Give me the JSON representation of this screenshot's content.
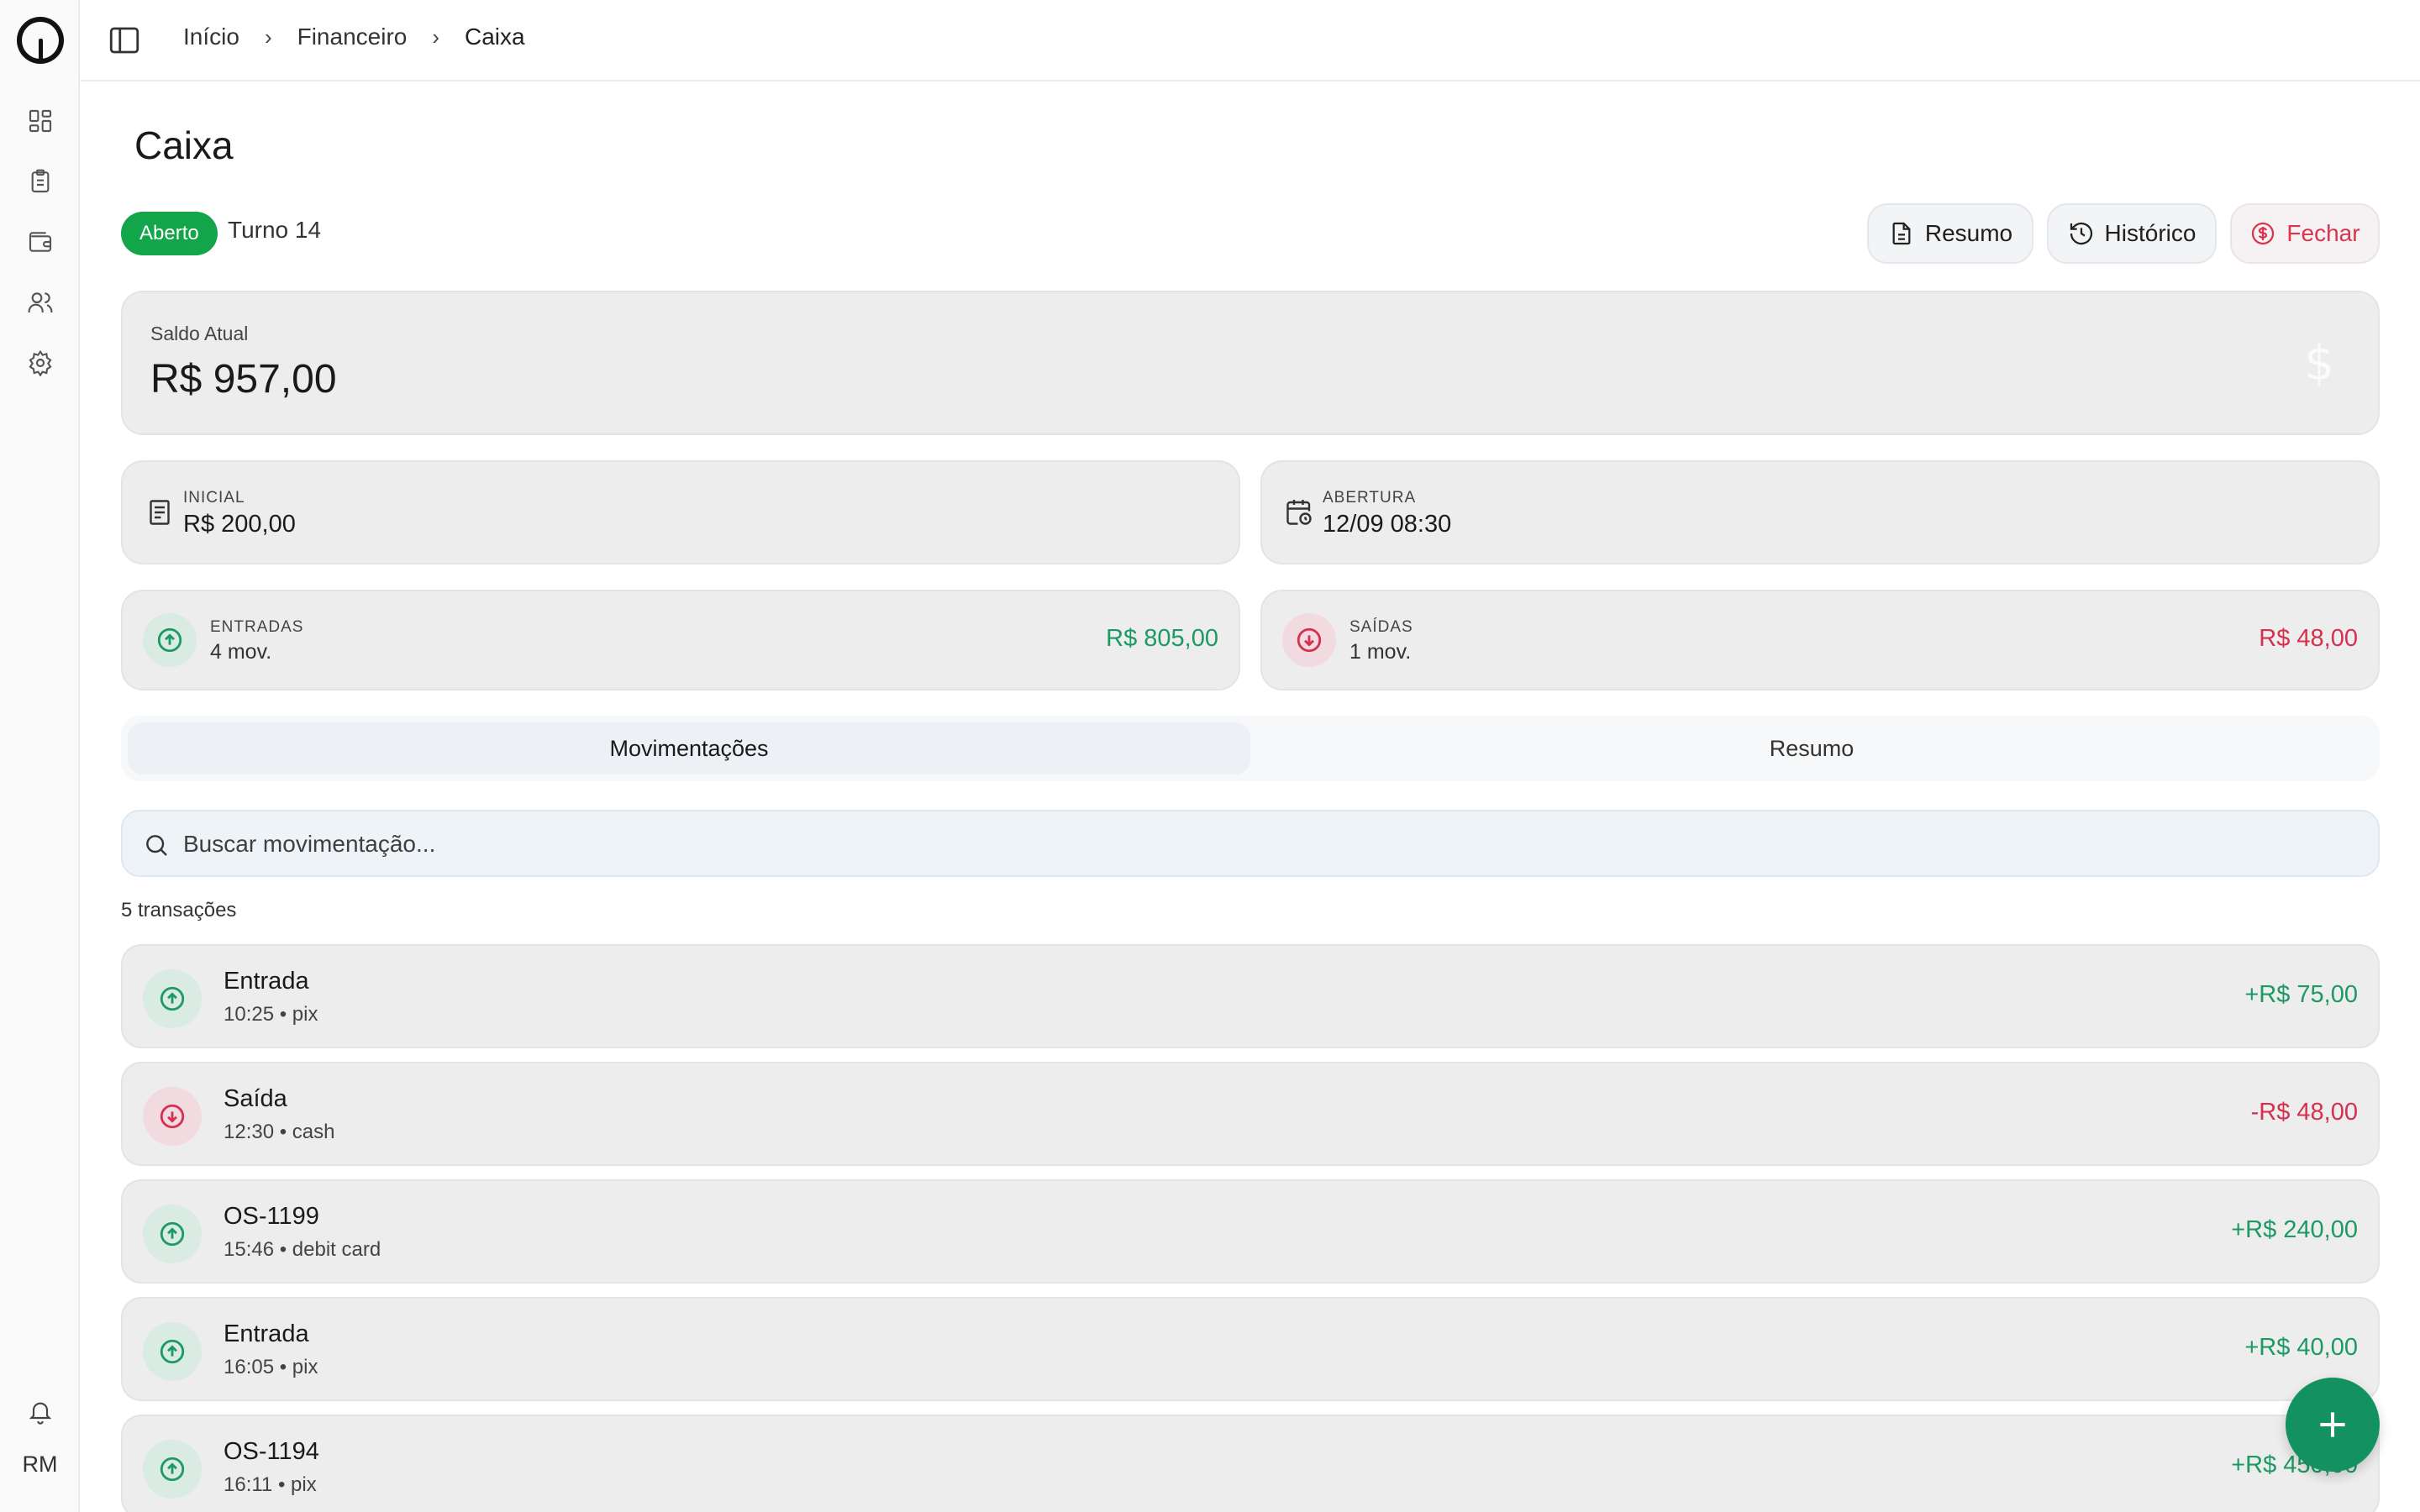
{
  "sidebar": {
    "items": [
      {
        "icon": "dashboard-icon"
      },
      {
        "icon": "clipboard-icon"
      },
      {
        "icon": "wallet-icon"
      },
      {
        "icon": "users-icon"
      },
      {
        "icon": "gear-icon"
      }
    ],
    "notifications_icon": "bell-icon",
    "user_initials": "RM"
  },
  "breadcrumb": [
    "Início",
    "Financeiro",
    "Caixa"
  ],
  "page": {
    "title": "Caixa"
  },
  "status": {
    "badge": "Aberto",
    "shift": "Turno 14"
  },
  "actions": {
    "resumo": "Resumo",
    "historico": "Histórico",
    "fechar": "Fechar"
  },
  "balance": {
    "label": "Saldo Atual",
    "value": "R$ 957,00",
    "symbol": "$"
  },
  "info": {
    "inicial": {
      "label": "INICIAL",
      "value": "R$ 200,00"
    },
    "abertura": {
      "label": "ABERTURA",
      "value": "12/09 08:30"
    }
  },
  "stats": {
    "entradas": {
      "label": "ENTRADAS",
      "count": "4 mov.",
      "amount": "R$ 805,00"
    },
    "saidas": {
      "label": "SAÍDAS",
      "count": "1 mov.",
      "amount": "R$ 48,00"
    }
  },
  "tabs": [
    {
      "label": "Movimentações",
      "active": true
    },
    {
      "label": "Resumo",
      "active": false
    }
  ],
  "search": {
    "placeholder": "Buscar movimentação..."
  },
  "transactions_count": "5 transações",
  "transactions": [
    {
      "type": "in",
      "title": "Entrada",
      "subtitle": "10:25 • pix",
      "amount": "+R$ 75,00"
    },
    {
      "type": "out",
      "title": "Saída",
      "subtitle": "12:30 • cash",
      "amount": "-R$ 48,00"
    },
    {
      "type": "in",
      "title": "OS-1199",
      "subtitle": "15:46 • debit card",
      "amount": "+R$ 240,00"
    },
    {
      "type": "in",
      "title": "Entrada",
      "subtitle": "16:05 • pix",
      "amount": "+R$ 40,00"
    },
    {
      "type": "in",
      "title": "OS-1194",
      "subtitle": "16:11 • pix",
      "amount": "+R$ 450,00"
    }
  ],
  "colors": {
    "accent": "#12a54a",
    "positive": "#1c9a63",
    "negative": "#d6304f",
    "fab": "#13915f"
  }
}
